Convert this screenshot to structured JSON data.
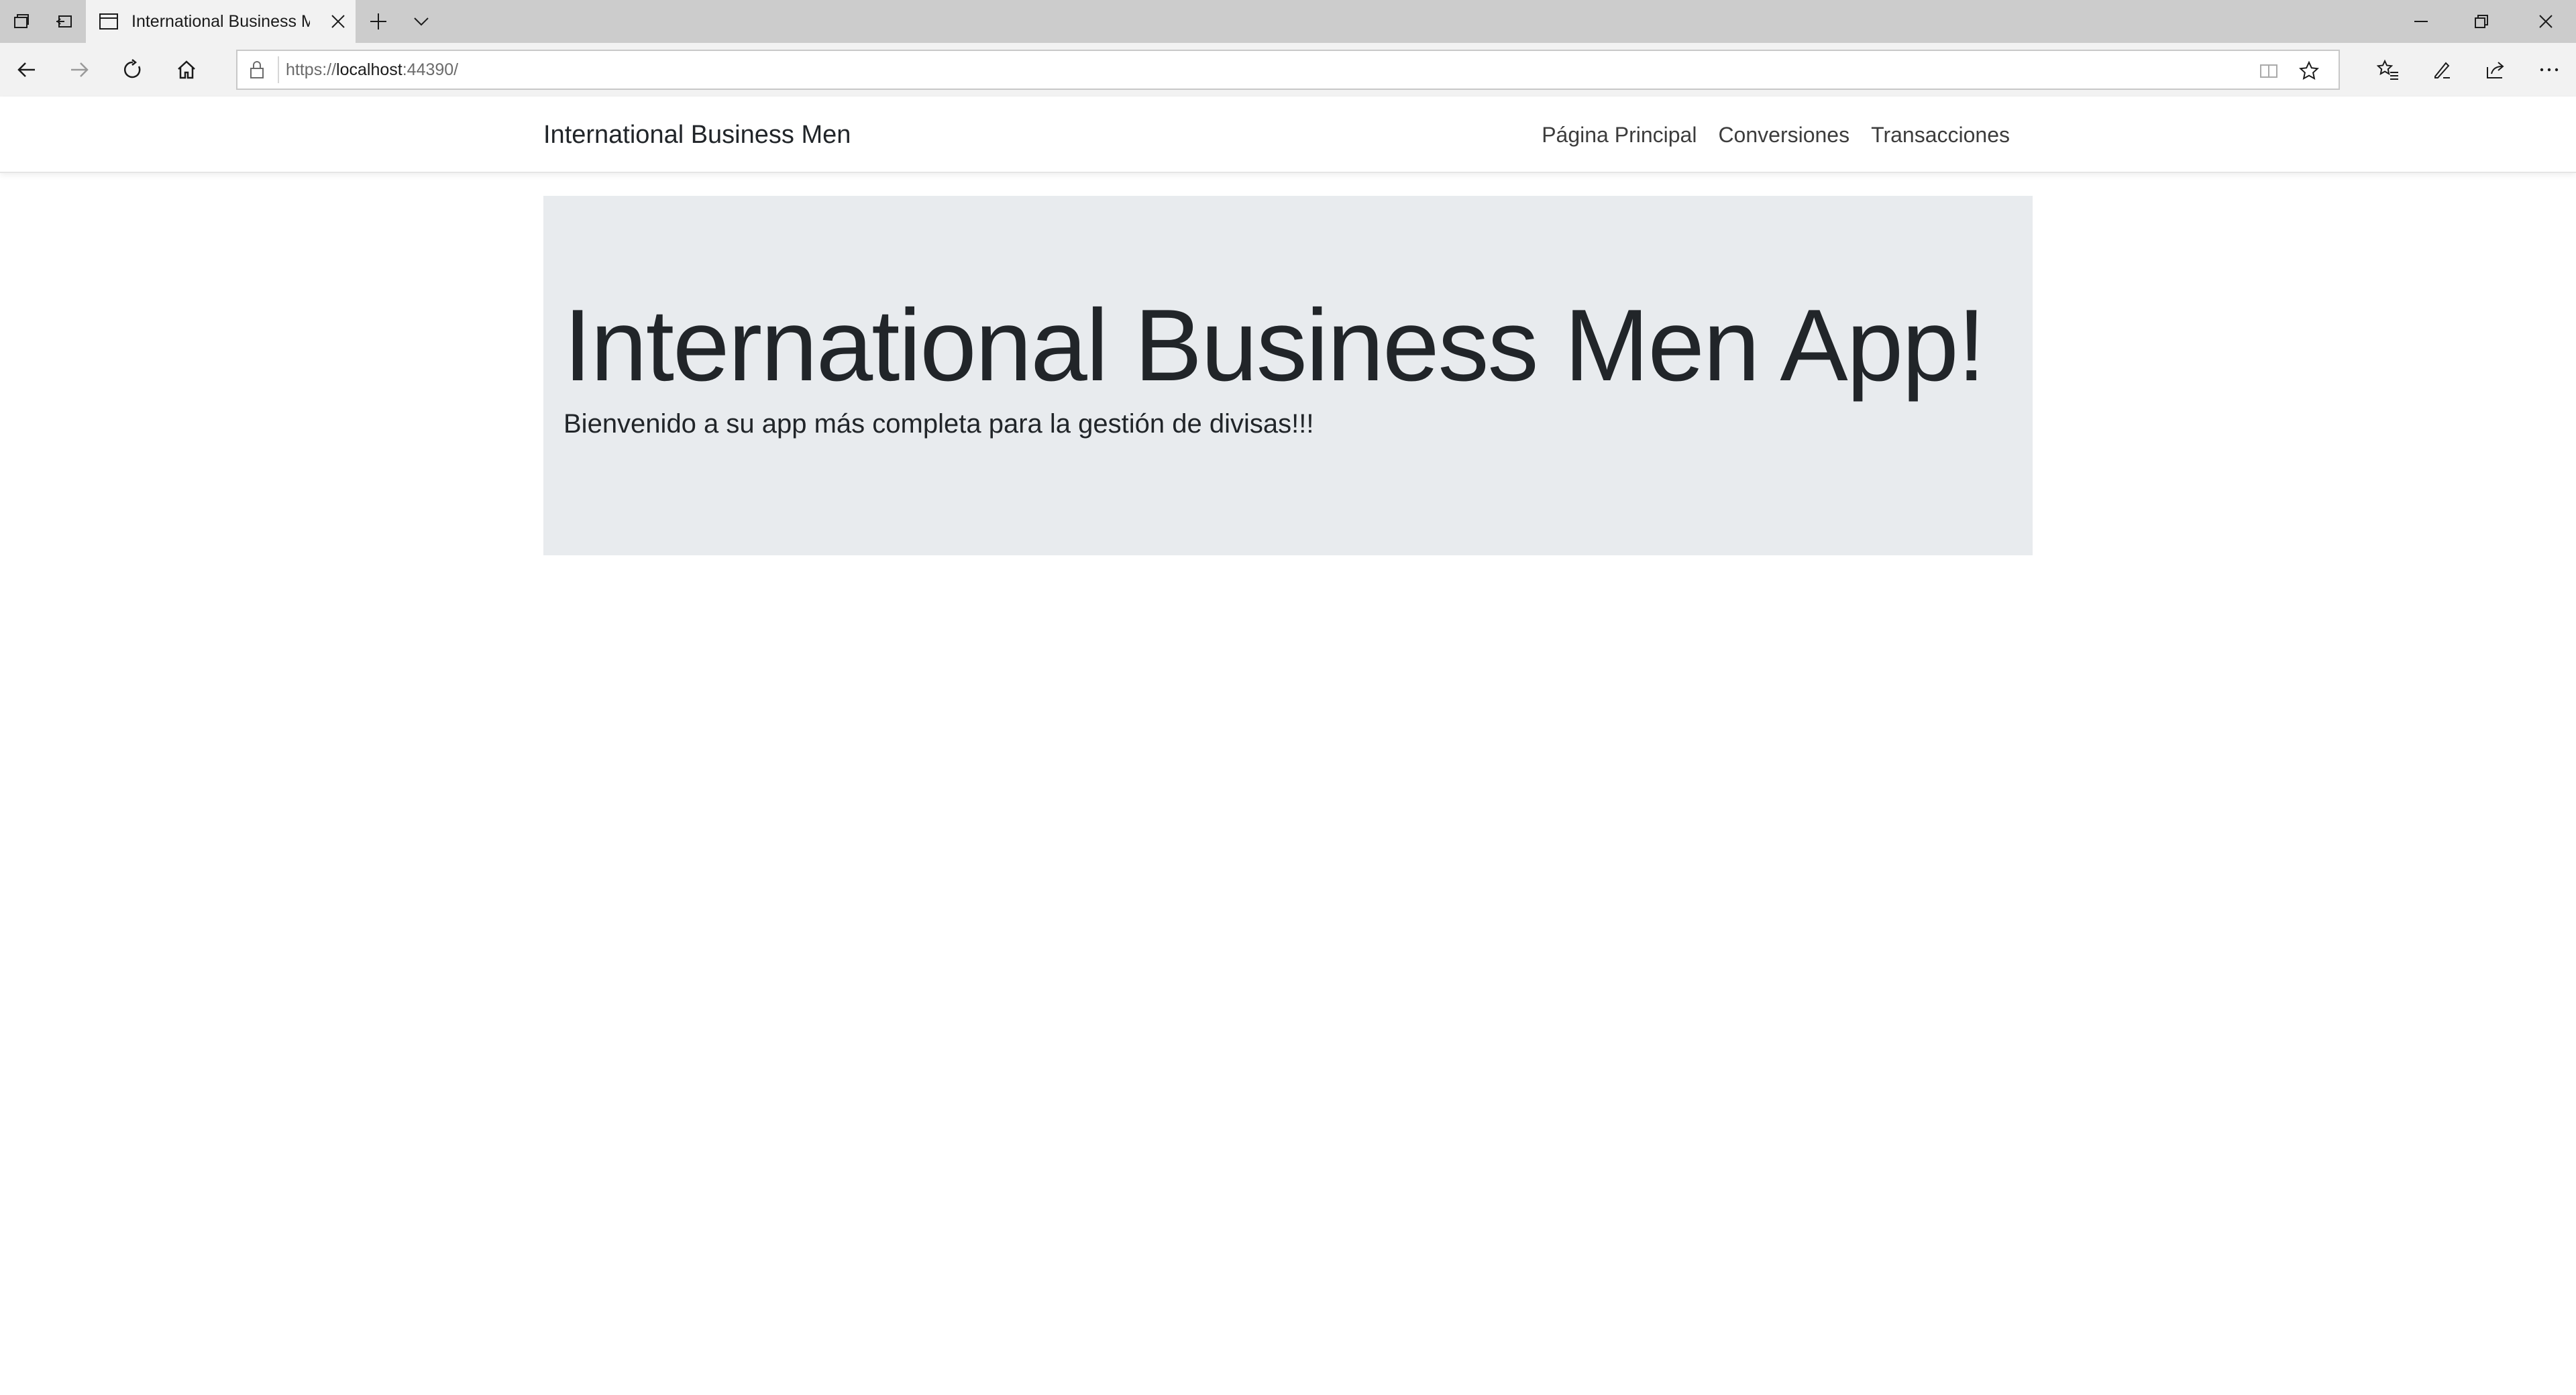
{
  "browser": {
    "tab": {
      "title": "International Business Men"
    },
    "address": {
      "scheme": "https://",
      "host": "localhost",
      "port": ":44390/"
    }
  },
  "site": {
    "brand": "International Business Men",
    "nav": [
      "Página Principal",
      "Conversiones",
      "Transacciones"
    ]
  },
  "hero": {
    "title": "International Business Men App!",
    "subtitle": "Bienvenido a su app más completa para la gestión de divisas!!!"
  },
  "colors": {
    "chrome_titlebar": "#cccccc",
    "chrome_toolbar": "#f2f2f2",
    "jumbotron_bg": "#e8ebee",
    "text": "#212529"
  }
}
